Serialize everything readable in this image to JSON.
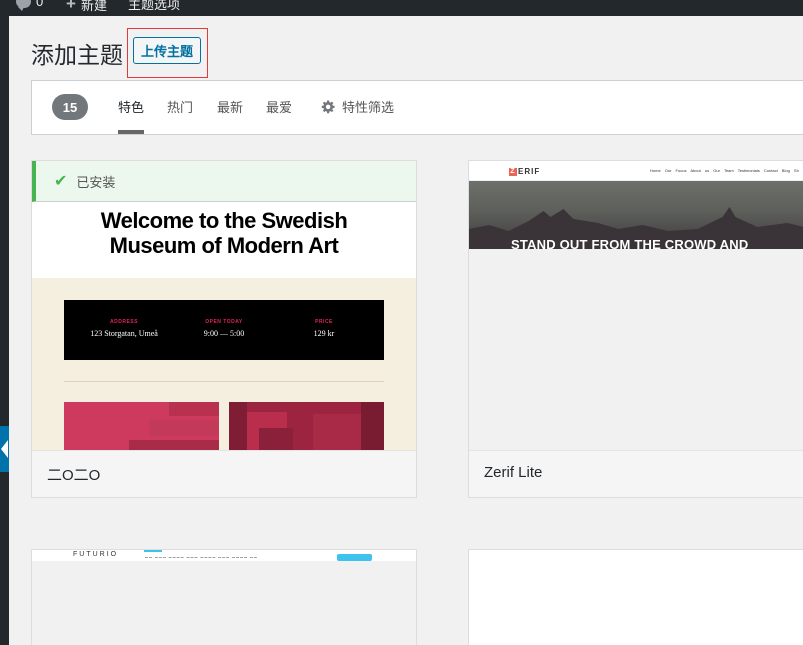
{
  "admin_bar": {
    "comments_count": "0",
    "new_label": "新建",
    "theme_options_label": "主题选项"
  },
  "header": {
    "title": "添加主题",
    "upload_button": "上传主题"
  },
  "filter_bar": {
    "count": "15",
    "tabs": [
      {
        "label": "特色",
        "current": true
      },
      {
        "label": "热门"
      },
      {
        "label": "最新"
      },
      {
        "label": "最爱"
      }
    ],
    "feature_filter_label": "特性筛选"
  },
  "themes": [
    {
      "name": "二O二O",
      "installed_label": "已安装",
      "screenshot": {
        "heading_line1": "Welcome to the Swedish",
        "heading_line2": "Museum of Modern Art",
        "info": [
          {
            "label": "ADDRESS",
            "value": "123 Storgatan, Umeå"
          },
          {
            "label": "OPEN TODAY",
            "value": "9:00 — 5:00"
          },
          {
            "label": "PRICE",
            "value": "129 kr"
          }
        ]
      }
    },
    {
      "name": "Zerif Lite",
      "screenshot": {
        "logo_initial": "Z",
        "logo_rest": "ERIF",
        "nav": "Home  Our Focus  About us  Our Team  Testimonials  Contact  Blog  Sh",
        "headline": "STAND OUT FROM THE CROWD AND"
      }
    },
    {
      "name": "",
      "screenshot": {
        "logo": "FUTURIO"
      }
    },
    {
      "name": ""
    }
  ],
  "colors": {
    "accent": "#0071a1",
    "installed_green": "#46b450",
    "admin_dark": "#23282d"
  }
}
